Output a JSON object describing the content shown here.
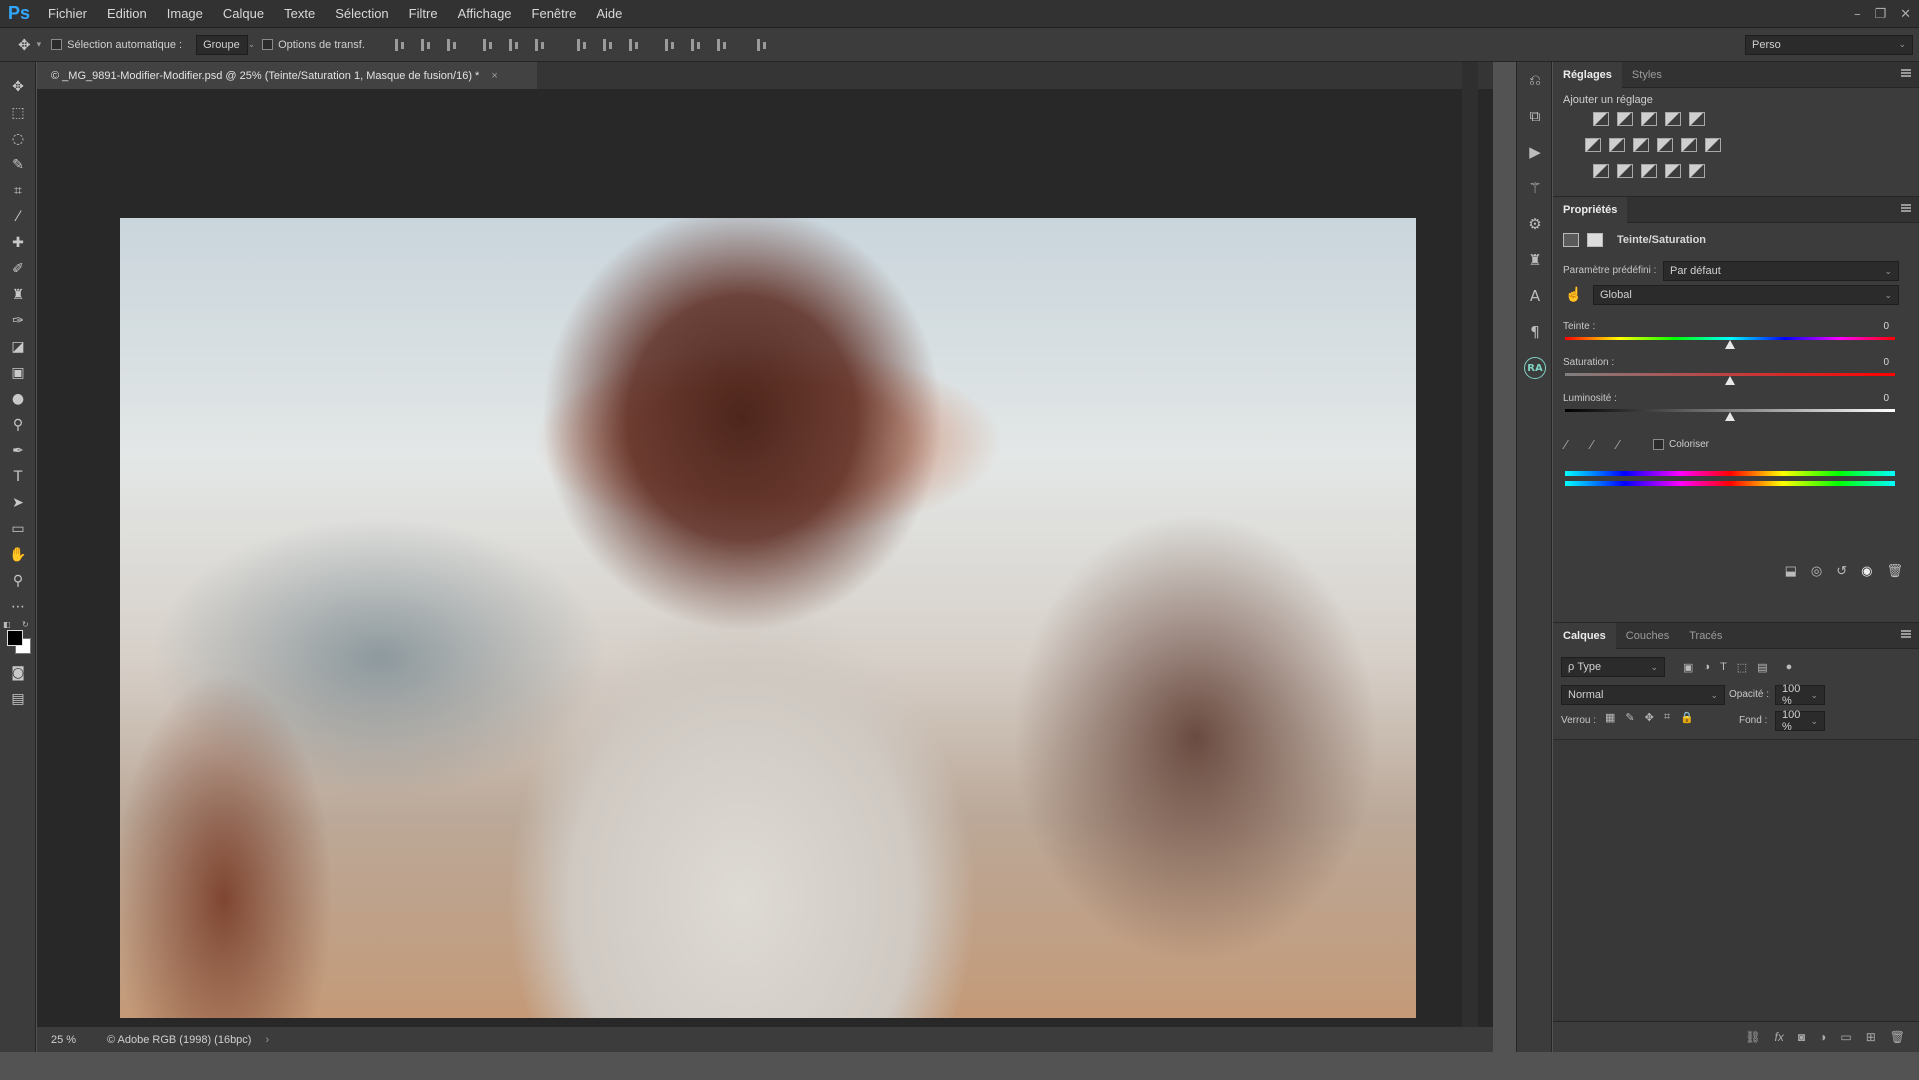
{
  "app": {
    "logo": "Ps"
  },
  "menu": [
    "Fichier",
    "Edition",
    "Image",
    "Calque",
    "Texte",
    "Sélection",
    "Filtre",
    "Affichage",
    "Fenêtre",
    "Aide"
  ],
  "window_controls": {
    "minimize": "–",
    "restore": "❐",
    "close": "✕"
  },
  "options": {
    "auto_select_label": "Sélection automatique :",
    "auto_select_value": "Groupe",
    "transform_label": "Options de transf.",
    "workspace": "Perso"
  },
  "tools": [
    "move-icon",
    "marquee-icon",
    "lasso-icon",
    "quick-select-icon",
    "crop-icon",
    "eyedropper-icon",
    "healing-icon",
    "brush-icon",
    "stamp-icon",
    "history-brush-icon",
    "eraser-icon",
    "gradient-icon",
    "blur-icon",
    "dodge-icon",
    "pen-icon",
    "type-icon",
    "path-select-icon",
    "rectangle-icon",
    "hand-icon",
    "zoom-icon",
    "more-icon"
  ],
  "document": {
    "tab_title": "© _MG_9891-Modifier-Modifier.psd @ 25% (Teinte/Saturation 1, Masque de fusion/16) *",
    "tab_close": "×",
    "zoom": "25 %",
    "profile": "© Adobe RGB (1998) (16bpc)",
    "status_more": "›"
  },
  "dock_badge": "RA",
  "adjustments": {
    "tabs": [
      "Réglages",
      "Styles"
    ],
    "title": "Ajouter un réglage"
  },
  "properties": {
    "tab": "Propriétés",
    "name": "Teinte/Saturation",
    "preset_label": "Paramètre prédéfini :",
    "preset_value": "Par défaut",
    "channel": "Global",
    "hue_label": "Teinte :",
    "hue_value": "0",
    "saturation_label": "Saturation :",
    "saturation_value": "0",
    "lightness_label": "Luminosité :",
    "lightness_value": "0",
    "colorize_label": "Coloriser"
  },
  "layers": {
    "tabs": [
      "Calques",
      "Couches",
      "Tracés"
    ],
    "filter": "ρ Type",
    "blend_mode": "Normal",
    "opacity_label": "Opacité :",
    "opacity_value": "100 %",
    "lock_label": "Verrou :",
    "fill_label": "Fond :",
    "fill_value": "100 %"
  }
}
